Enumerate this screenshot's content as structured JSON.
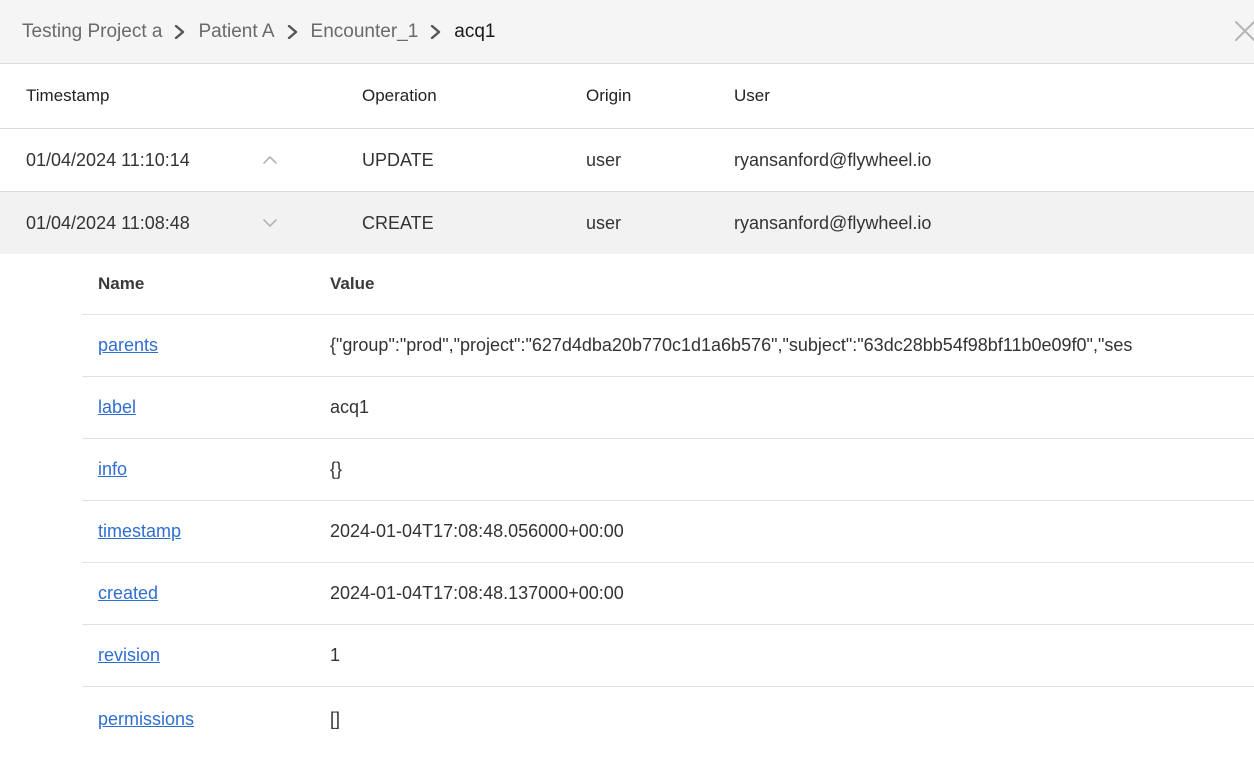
{
  "breadcrumb": {
    "items": [
      "Testing Project a",
      "Patient A",
      "Encounter_1",
      "acq1"
    ]
  },
  "audit": {
    "columns": {
      "timestamp": "Timestamp",
      "operation": "Operation",
      "origin": "Origin",
      "user": "User"
    },
    "rows": [
      {
        "timestamp": "01/04/2024 11:10:14",
        "operation": "UPDATE",
        "origin": "user",
        "user": "ryansanford@flywheel.io",
        "expanded": false
      },
      {
        "timestamp": "01/04/2024 11:08:48",
        "operation": "CREATE",
        "origin": "user",
        "user": "ryansanford@flywheel.io",
        "expanded": true
      }
    ]
  },
  "detail": {
    "columns": {
      "name": "Name",
      "value": "Value"
    },
    "rows": [
      {
        "name": "parents",
        "value": "{\"group\":\"prod\",\"project\":\"627d4dba20b770c1d1a6b576\",\"subject\":\"63dc28bb54f98bf11b0e09f0\",\"ses"
      },
      {
        "name": "label",
        "value": "acq1"
      },
      {
        "name": "info",
        "value": "{}"
      },
      {
        "name": "timestamp",
        "value": "2024-01-04T17:08:48.056000+00:00"
      },
      {
        "name": "created",
        "value": "2024-01-04T17:08:48.137000+00:00"
      },
      {
        "name": "revision",
        "value": "1"
      },
      {
        "name": "permissions",
        "value": "[]"
      }
    ]
  },
  "colors": {
    "link": "#2f6ed1",
    "header_bg": "#f5f5f5",
    "expanded_row_bg": "#f2f2f2",
    "divider": "#dcdcdc"
  },
  "icons": {
    "breadcrumb_separator": "chevron-right-icon",
    "close": "close-icon",
    "collapse": "chevron-up-icon",
    "expand": "chevron-down-icon"
  }
}
